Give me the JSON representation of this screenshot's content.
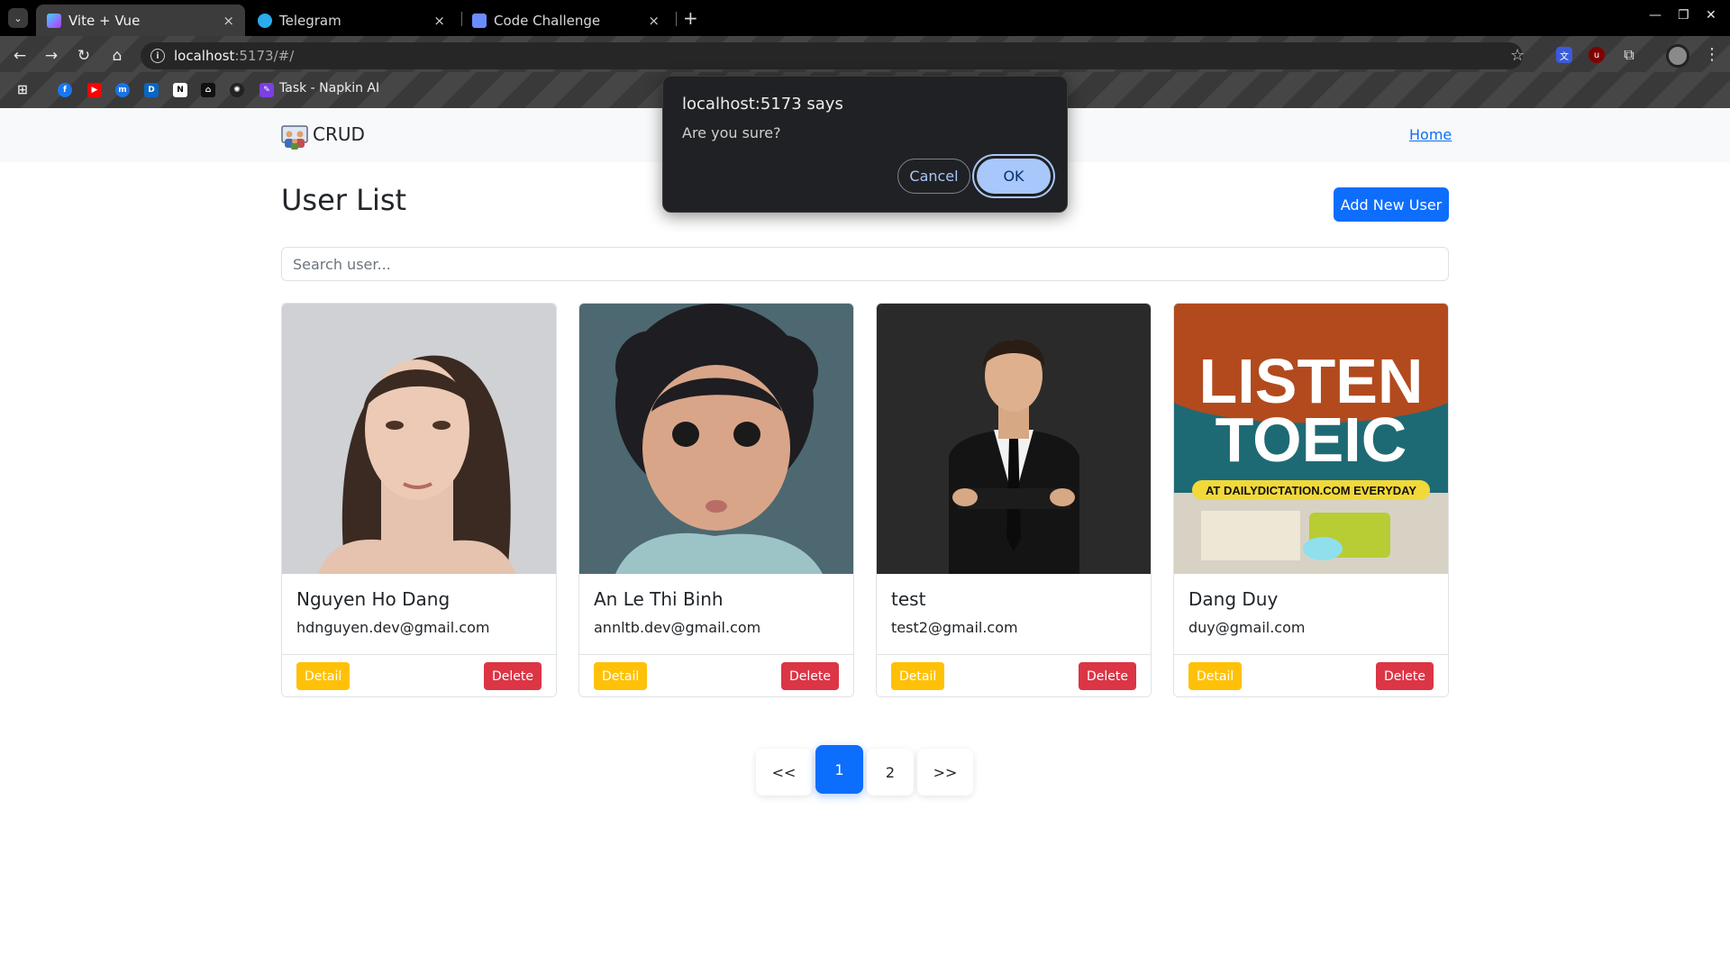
{
  "browser": {
    "tabs": [
      {
        "title": "Vite + Vue",
        "active": true
      },
      {
        "title": "Telegram",
        "active": false
      },
      {
        "title": "Code Challenge",
        "active": false
      }
    ],
    "address": {
      "host": "localhost",
      "path": ":5173/#/"
    },
    "bookmark_label": "Task - Napkin AI",
    "tab_close_glyph": "×",
    "new_tab_glyph": "+"
  },
  "app": {
    "brand": "CRUD",
    "nav_home": "Home",
    "page_title": "User List",
    "add_button": "Add New User",
    "search_placeholder": "Search user...",
    "detail_label": "Detail",
    "delete_label": "Delete",
    "users": [
      {
        "name": "Nguyen Ho Dang",
        "email": "hdnguyen.dev@gmail.com"
      },
      {
        "name": "An Le Thi Binh",
        "email": "annltb.dev@gmail.com"
      },
      {
        "name": "test",
        "email": "test2@gmail.com"
      },
      {
        "name": "Dang Duy",
        "email": "duy@gmail.com"
      }
    ],
    "poster": {
      "line1": "LISTEN",
      "line2": "TOEIC",
      "banner": "AT DAILYDICTATION.COM EVERYDAY"
    },
    "pagination": {
      "prev": "<<",
      "pages": [
        "1",
        "2"
      ],
      "current": "1",
      "next": ">>"
    }
  },
  "dialog": {
    "title": "localhost:5173 says",
    "message": "Are you sure?",
    "cancel": "Cancel",
    "ok": "OK"
  },
  "colors": {
    "primary": "#0d6efd",
    "warning": "#ffc107",
    "danger": "#dc3545",
    "dialog_bg": "#202124",
    "dialog_accent": "#a8c7fa"
  }
}
